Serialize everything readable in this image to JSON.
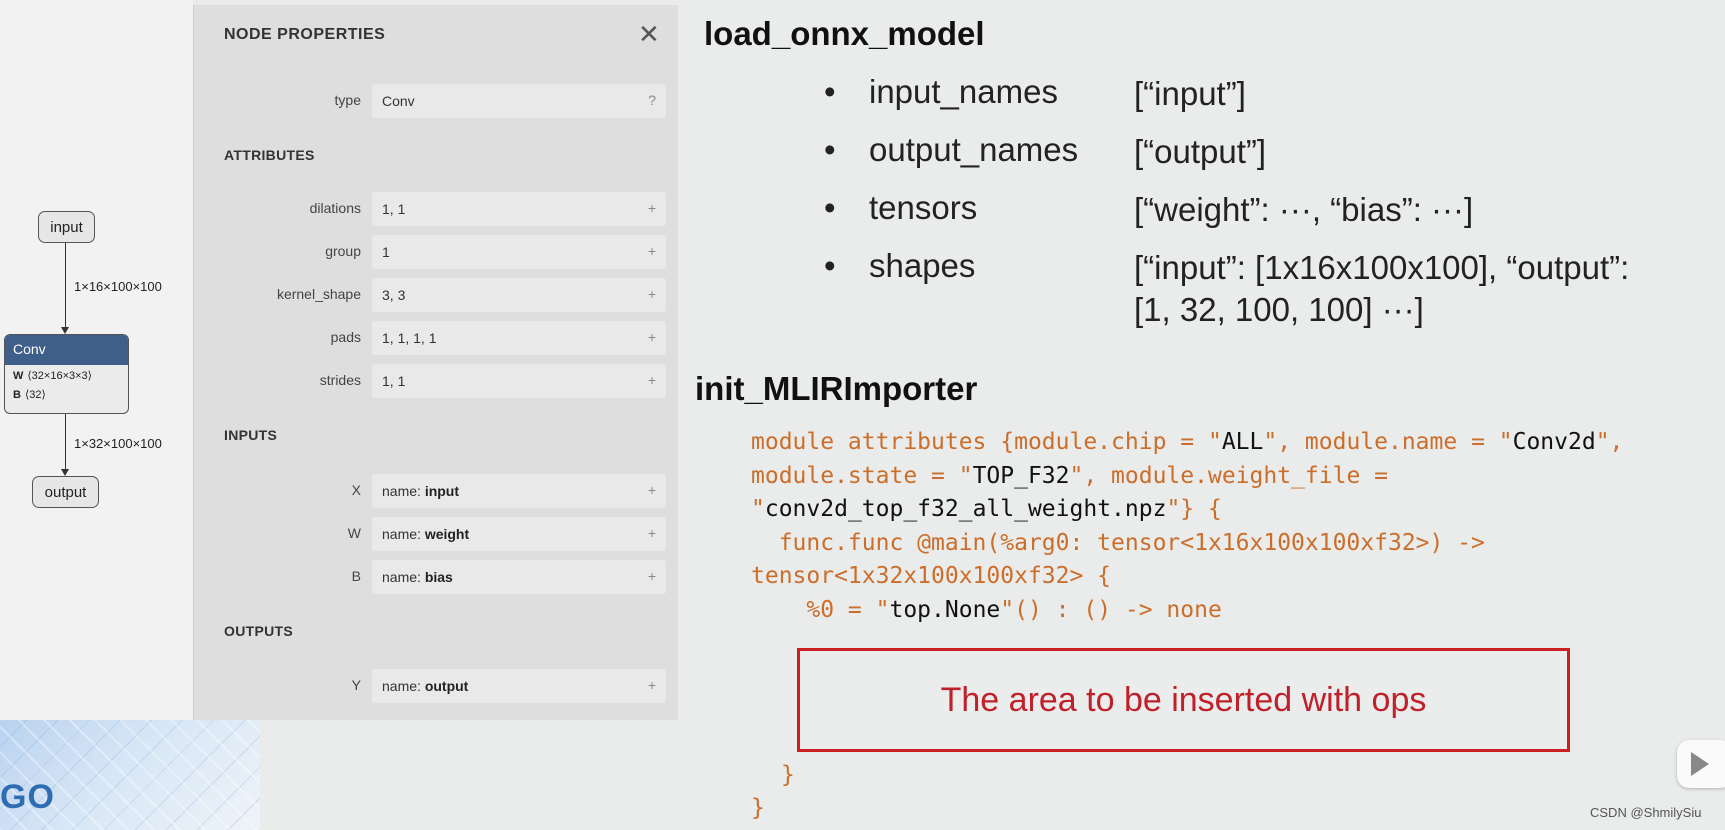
{
  "graph": {
    "input_node": "input",
    "edge_in_label": "1×16×100×100",
    "conv": {
      "title": "Conv",
      "w_key": "W",
      "w_val": "⟨32×16×3×3⟩",
      "b_key": "B",
      "b_val": "⟨32⟩"
    },
    "edge_out_label": "1×32×100×100",
    "output_node": "output"
  },
  "panel": {
    "title": "NODE PROPERTIES",
    "close_icon": "close-icon",
    "type_row": {
      "label": "type",
      "value": "Conv",
      "button": "?"
    },
    "attributes_header": "ATTRIBUTES",
    "attributes": [
      {
        "label": "dilations",
        "value": "1, 1",
        "button": "+"
      },
      {
        "label": "group",
        "value": "1",
        "button": "+"
      },
      {
        "label": "kernel_shape",
        "value": "3, 3",
        "button": "+"
      },
      {
        "label": "pads",
        "value": "1, 1, 1, 1",
        "button": "+"
      },
      {
        "label": "strides",
        "value": "1, 1",
        "button": "+"
      }
    ],
    "inputs_header": "INPUTS",
    "inputs": [
      {
        "label": "X",
        "prefix": "name: ",
        "value": "input",
        "button": "+"
      },
      {
        "label": "W",
        "prefix": "name: ",
        "value": "weight",
        "button": "+"
      },
      {
        "label": "B",
        "prefix": "name: ",
        "value": "bias",
        "button": "+"
      }
    ],
    "outputs_header": "OUTPUTS",
    "outputs": [
      {
        "label": "Y",
        "prefix": "name: ",
        "value": "output",
        "button": "+"
      }
    ]
  },
  "decor": {
    "logo_text": "GO"
  },
  "slide": {
    "heading1": "load_onnx_model",
    "bullets": [
      {
        "dot": "•",
        "key": "input_names",
        "value": "[“input”]"
      },
      {
        "dot": "•",
        "key": "output_names",
        "value": "[“output”]"
      },
      {
        "dot": "•",
        "key": "tensors",
        "value": "[“weight”: ···, “bias”: ···]"
      },
      {
        "dot": "•",
        "key": "shapes",
        "value_line1": "[“input”: [1x16x100x100], “output”:",
        "value_line2": "[1, 32, 100, 100] ···]"
      }
    ],
    "heading2": "init_MLIRImporter",
    "code": {
      "l1a": "module attributes {module.chip = \"",
      "l1b": "ALL",
      "l1c": "\", module.name = \"",
      "l1d": "Conv2d",
      "l1e": "\",",
      "l2a": "module.state = \"",
      "l2b": "TOP_F32",
      "l2c": "\", module.weight_file =",
      "l3a": "\"",
      "l3b": "conv2d_top_f32_all_weight.npz",
      "l3c": "\"} {",
      "l4": "  func.func @main(%arg0: tensor<1x16x100x100xf32>) ->",
      "l5": "tensor<1x32x100x100xf32> {",
      "l6a": "    %0 = \"",
      "l6b": "top.None",
      "l6c": "\"() : () -> none"
    },
    "insert_text": "The area to be inserted with ops",
    "brace_inner": "}",
    "brace_outer": "}"
  },
  "watermark": "CSDN @ShmilySiu"
}
